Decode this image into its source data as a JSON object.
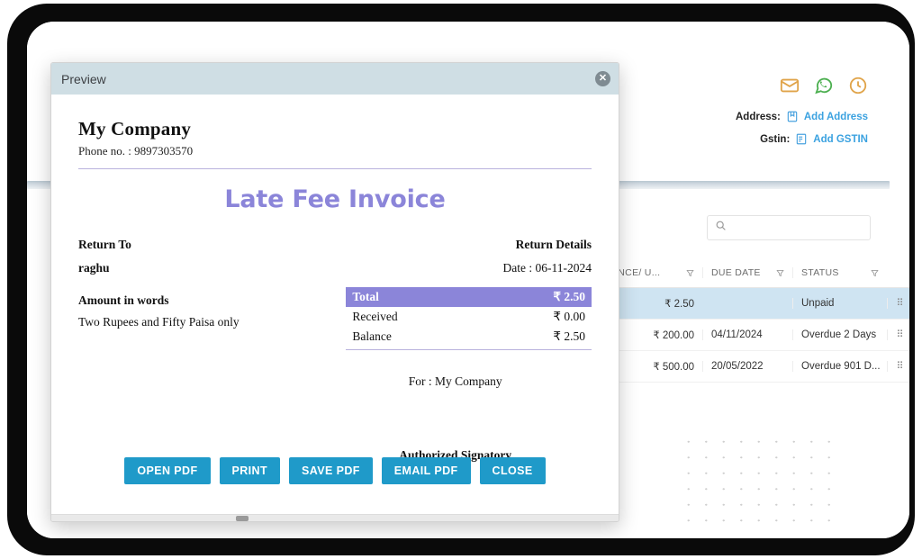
{
  "app": {
    "top_icons": [
      {
        "name": "message-icon",
        "color": "#e0a44a"
      },
      {
        "name": "whatsapp-icon",
        "color": "#4caf50"
      },
      {
        "name": "history-clock-icon",
        "color": "#e0a44a"
      }
    ],
    "address": {
      "label": "Address:",
      "icon": "address-book-icon",
      "link": "Add Address"
    },
    "gstin": {
      "label": "Gstin:",
      "icon": "gstin-document-icon",
      "link": "Add GSTIN"
    },
    "search": {
      "value": "",
      "placeholder": ""
    },
    "table": {
      "columns": [
        {
          "label": "ANCE/ U...",
          "filter_icon": "filter-funnel-icon"
        },
        {
          "label": "DUE DATE",
          "filter_icon": "filter-funnel-icon"
        },
        {
          "label": "STATUS",
          "filter_icon": "filter-funnel-icon"
        }
      ],
      "rows": [
        {
          "balance": "₹ 2.50",
          "due_date": "",
          "status": "Unpaid",
          "selected": true
        },
        {
          "balance": "₹ 200.00",
          "due_date": "04/11/2024",
          "status": "Overdue 2 Days",
          "selected": false
        },
        {
          "balance": "₹ 500.00",
          "due_date": "20/05/2022",
          "status": "Overdue 901 D...",
          "selected": false
        }
      ],
      "row_grip_icon": "drag-grip-icon"
    }
  },
  "modal": {
    "title": "Preview",
    "close_icon": "close-icon",
    "company_name": "My Company",
    "company_phone": "Phone no. : 9897303570",
    "invoice_title": "Late Fee Invoice",
    "return_to_label": "Return To",
    "customer_name": "raghu",
    "amount_words_label": "Amount in words",
    "amount_words_value": "Two Rupees and Fifty Paisa only",
    "return_details_label": "Return Details",
    "invoice_date": "Date : 06-11-2024",
    "totals": [
      {
        "label": "Total",
        "value": "₹ 2.50",
        "highlight": true
      },
      {
        "label": "Received",
        "value": "₹ 0.00",
        "highlight": false
      },
      {
        "label": "Balance",
        "value": "₹ 2.50",
        "highlight": false
      }
    ],
    "for_company": "For : My Company",
    "signatory": "Authorized Signatory",
    "buttons": [
      {
        "label": "OPEN PDF",
        "name": "open-pdf-button"
      },
      {
        "label": "PRINT",
        "name": "print-button"
      },
      {
        "label": "SAVE PDF",
        "name": "save-pdf-button"
      },
      {
        "label": "EMAIL PDF",
        "name": "email-pdf-button"
      },
      {
        "label": "CLOSE",
        "name": "close-button"
      }
    ],
    "accent_color": "#8b85d9",
    "button_color": "#1f9ac9",
    "titlebar_color": "#cfdee4"
  }
}
